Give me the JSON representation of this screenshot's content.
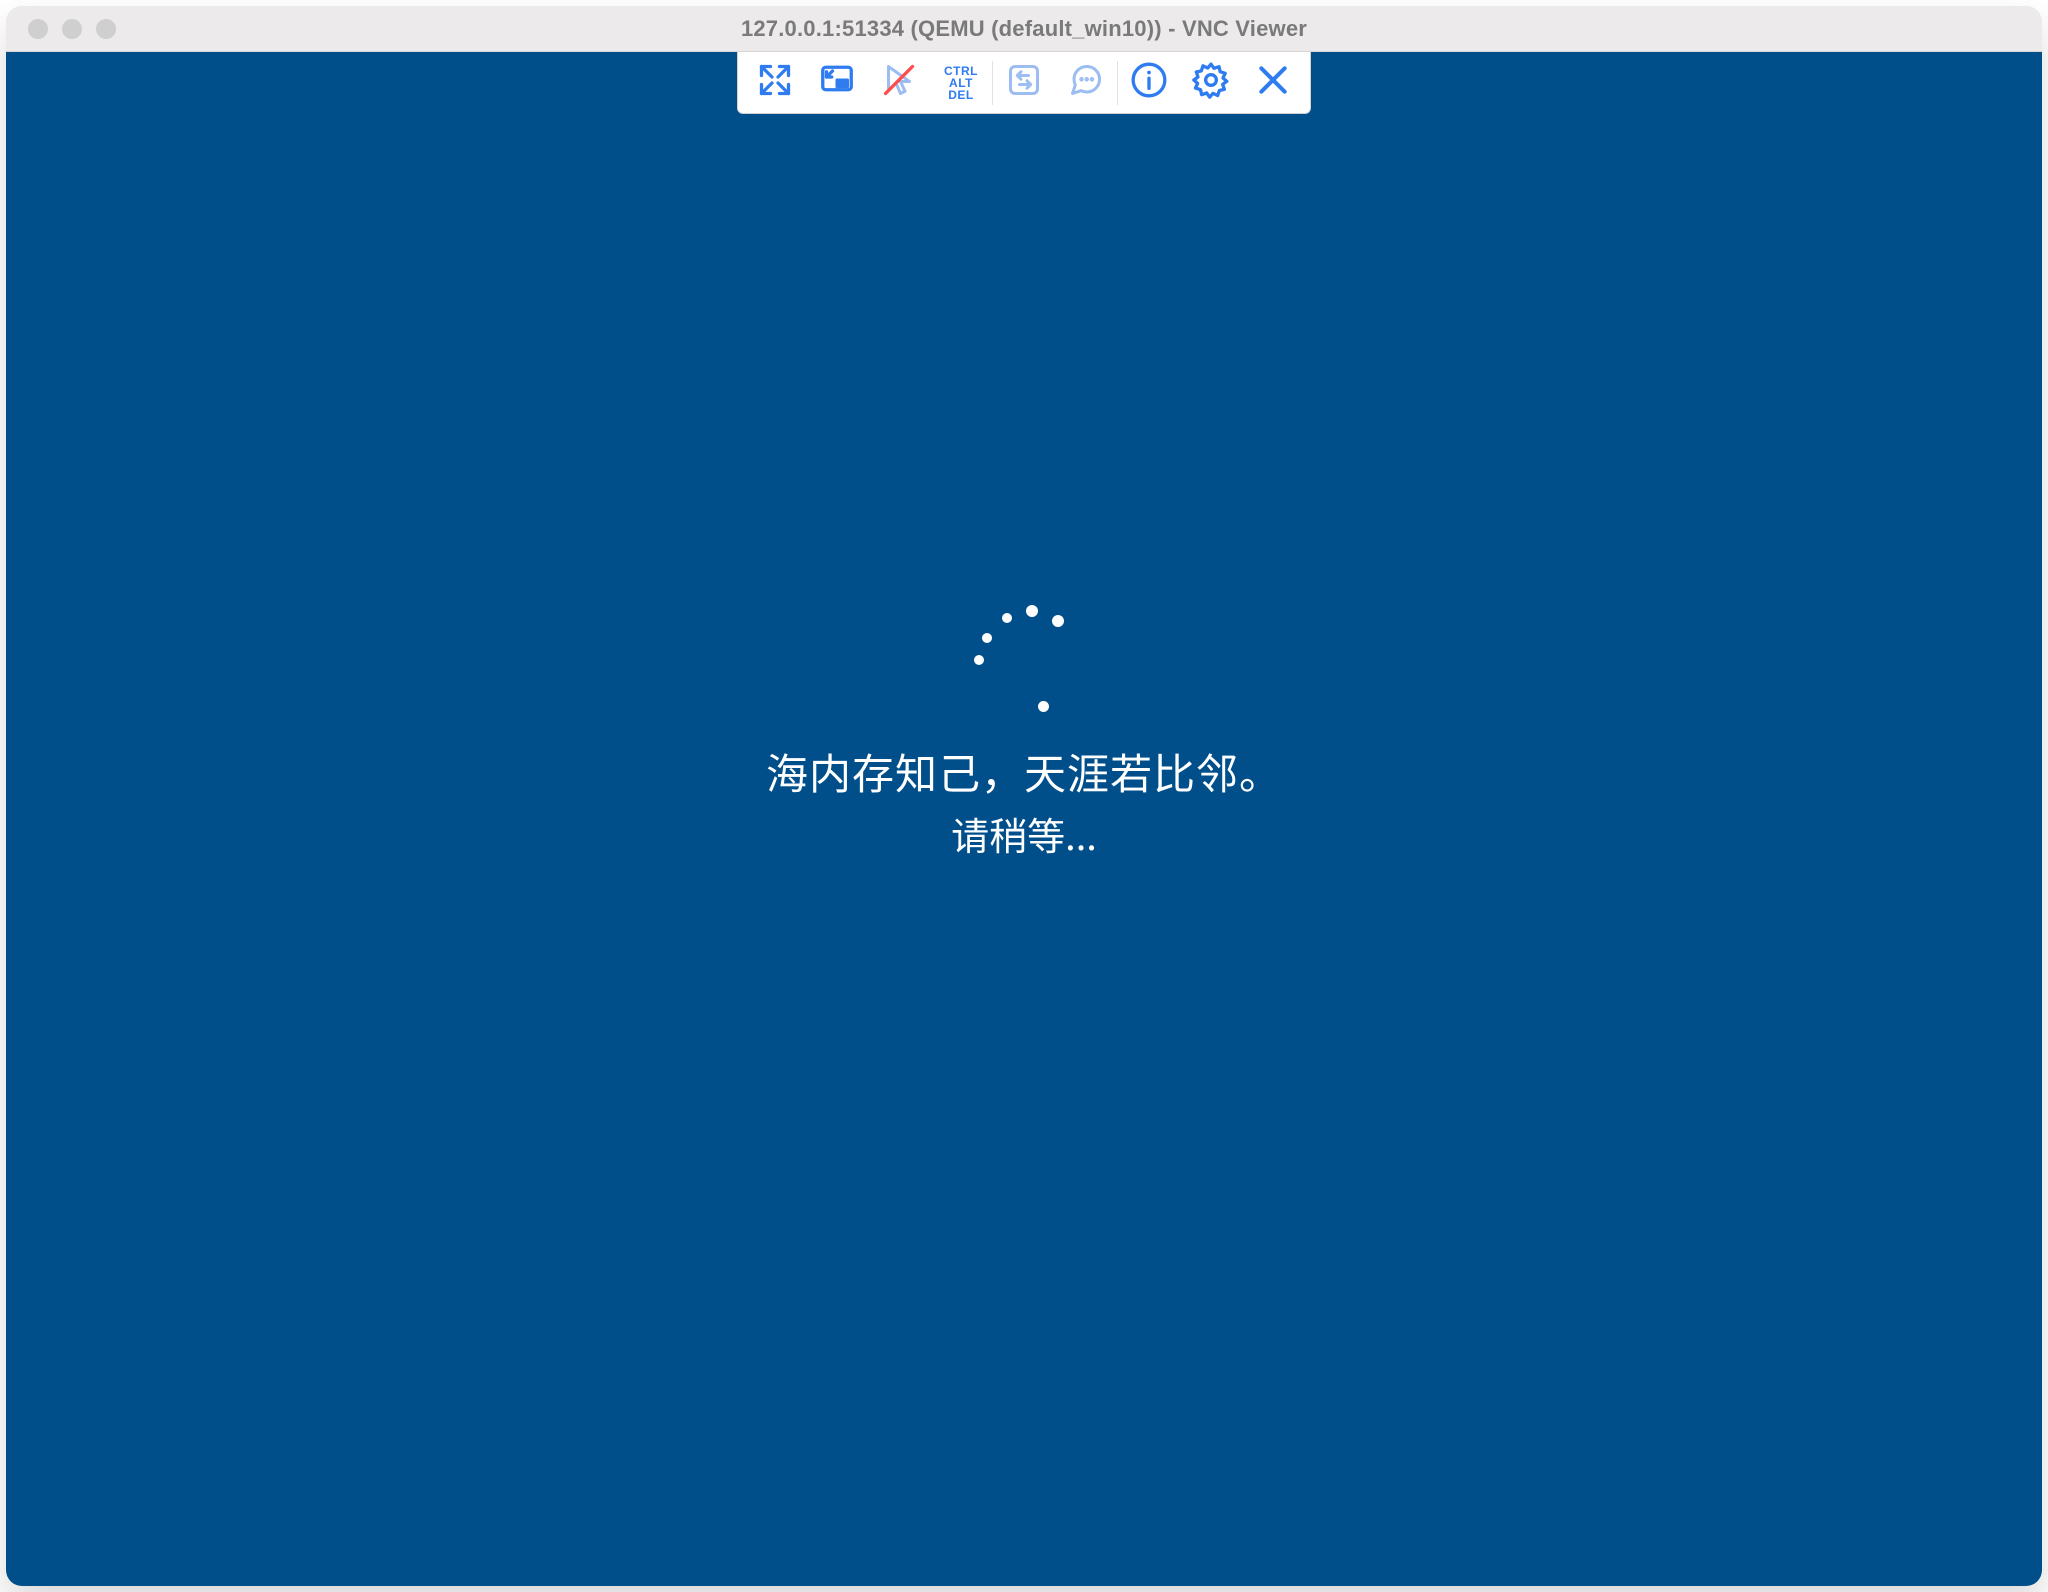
{
  "window": {
    "title": "127.0.0.1:51334 (QEMU (default_win10)) - VNC Viewer"
  },
  "vnc_toolbar": {
    "fullscreen_tip": "Enter full screen",
    "pin_tip": "Pin toolbar",
    "pointer_tip": "Relative pointer motion",
    "cad_lines": [
      "CTRL",
      "ALT",
      "DEL"
    ],
    "transfer_tip": "File transfer",
    "chat_tip": "Chat",
    "info_tip": "Session info",
    "settings_tip": "Settings",
    "close_tip": "Close connection"
  },
  "loading": {
    "line1": "海内存知己，天涯若比邻。",
    "line2": "请稍等..."
  }
}
